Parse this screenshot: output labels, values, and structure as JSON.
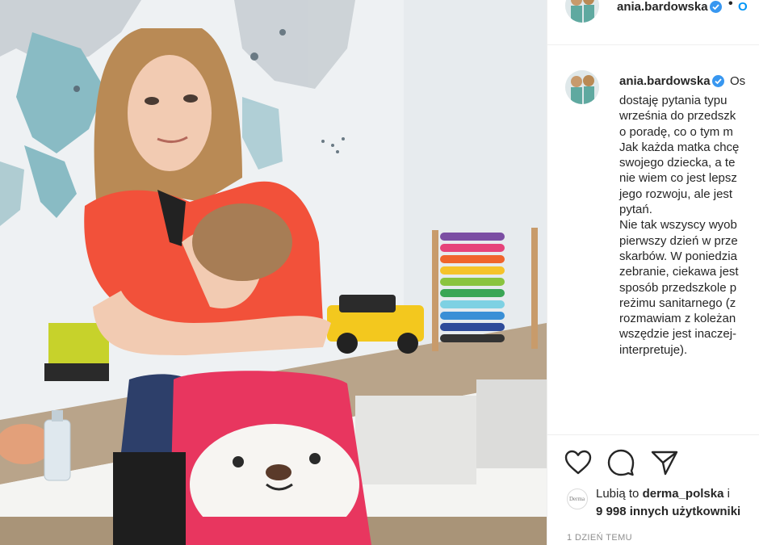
{
  "post": {
    "username": "ania.bardowska",
    "header_separator": "•",
    "header_follow": "O",
    "caption_first": "Os",
    "caption_lines": [
      "dostaję pytania typu",
      "września do przedszk",
      "o poradę, co o tym m",
      "Jak każda matka chcę",
      "swojego dziecka, a te",
      "nie wiem co jest lepsz",
      "jego rozwoju, ale jest",
      "pytań.",
      "Nie tak wszyscy wyob",
      "pierwszy dzień w prze",
      "skarbów. W poniedzia",
      "zebranie, ciekawa jest",
      "sposób przedszkole p",
      "reżimu sanitarnego (z",
      "rozmawiam z koleżan",
      "wszędzie jest inaczej-",
      "interpretuje)."
    ],
    "likes_prefix": "Lubią to",
    "likes_user": "derma_polska",
    "likes_connector": "i",
    "likes_others": "9 998 innych użytkowniki",
    "liker_avatar_text": "Derma",
    "timestamp": "1 DZIEŃ TEMU"
  },
  "icons": {
    "like": "heart-icon",
    "comment": "comment-icon",
    "share": "paper-plane-icon",
    "verified": "verified-badge-icon"
  },
  "colors": {
    "verified_blue": "#3897f0",
    "follow_blue": "#0095f6",
    "muted_text": "#8e8e8e",
    "border": "#efefef",
    "shirt_red": "#f2513a",
    "backpack_pink": "#e8365f"
  }
}
